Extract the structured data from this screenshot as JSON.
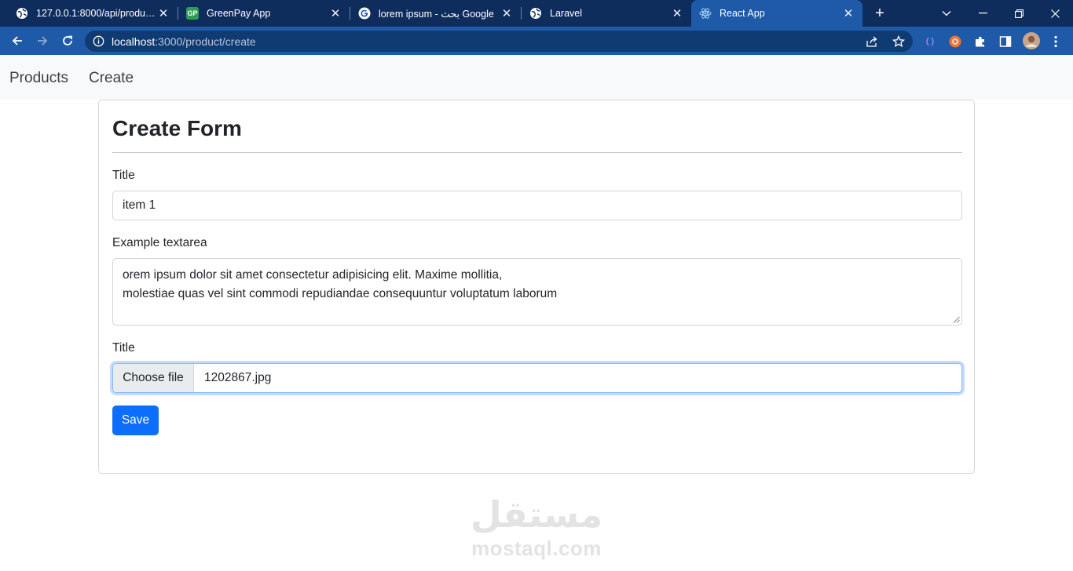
{
  "browser": {
    "tabs": [
      {
        "title": "127.0.0.1:8000/api/products",
        "icon": "globe-icon",
        "active": false
      },
      {
        "title": "GreenPay App",
        "icon": "greenpay-favicon",
        "favicon_text": "GP",
        "active": false
      },
      {
        "title": "lorem ipsum - بحث Google",
        "icon": "google-icon",
        "active": false
      },
      {
        "title": "Laravel",
        "icon": "globe-icon",
        "active": false
      },
      {
        "title": "React App",
        "icon": "react-icon",
        "active": true
      }
    ],
    "new_tab_label": "+",
    "close_glyph": "✕",
    "address": {
      "host": "localhost",
      "path": ":3000/product/create"
    },
    "colors": {
      "tab_strip": "#0f2d5c",
      "toolbar": "#1e5aa8",
      "omnibox": "#103a72"
    }
  },
  "navbar": {
    "links": [
      "Products",
      "Create"
    ]
  },
  "form": {
    "heading": "Create Form",
    "title_label": "Title",
    "title_value": "item 1",
    "textarea_label": "Example textarea",
    "textarea_lines": [
      "orem ipsum dolor sit amet consectetur adipisicing elit. Maxime mollitia,",
      "molestiae quas vel sint commodi repudiandae consequuntur voluptatum laborum"
    ],
    "file_label": "Title",
    "file_button": "Choose file",
    "file_name": "1202867.jpg",
    "save_button": "Save",
    "colors": {
      "primary": "#0d6efd"
    }
  },
  "watermark": {
    "arabic": "مستقل",
    "latin": "mostaql.com"
  }
}
